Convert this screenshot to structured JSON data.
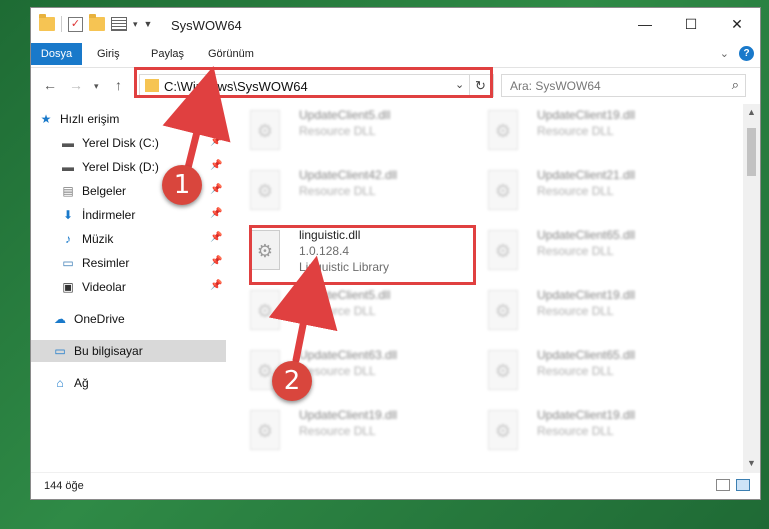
{
  "window": {
    "title": "SysWOW64"
  },
  "ribbon": {
    "tabs": [
      "Dosya",
      "Giriş",
      "Paylaş",
      "Görünüm"
    ]
  },
  "address": {
    "path": "C:\\Windows\\SysWOW64"
  },
  "search": {
    "placeholder": "Ara: SysWOW64"
  },
  "sidebar": {
    "items": [
      {
        "label": "Hızlı erişim",
        "icon": "star-icon"
      },
      {
        "label": "Yerel Disk (C:)",
        "icon": "drive-icon"
      },
      {
        "label": "Yerel Disk (D:)",
        "icon": "drive-icon"
      },
      {
        "label": "Belgeler",
        "icon": "documents-icon"
      },
      {
        "label": "İndirmeler",
        "icon": "download-icon"
      },
      {
        "label": "Müzik",
        "icon": "music-icon"
      },
      {
        "label": "Resimler",
        "icon": "pictures-icon"
      },
      {
        "label": "Videolar",
        "icon": "videos-icon"
      },
      {
        "label": "OneDrive",
        "icon": "cloud-icon"
      },
      {
        "label": "Bu bilgisayar",
        "icon": "computer-icon"
      },
      {
        "label": "Ağ",
        "icon": "network-icon"
      }
    ]
  },
  "files": [
    {
      "name": "UpdateClient5.dll",
      "type": "Resource DLL"
    },
    {
      "name": "UpdateClient19.dll",
      "type": "Resource DLL"
    },
    {
      "name": "UpdateClient42.dll",
      "type": "Resource DLL"
    },
    {
      "name": "UpdateClient21.dll",
      "type": "Resource DLL"
    },
    {
      "name": "linguistic.dll",
      "version": "1.0.128.4",
      "type": "Linguistic Library"
    },
    {
      "name": "UpdateClient65.dll",
      "type": "Resource DLL"
    },
    {
      "name": "UpdateClient5.dll",
      "type": "Resource DLL"
    },
    {
      "name": "UpdateClient19.dll",
      "type": "Resource DLL"
    },
    {
      "name": "UpdateClient63.dll",
      "type": "Resource DLL"
    },
    {
      "name": "UpdateClient65.dll",
      "type": "Resource DLL"
    },
    {
      "name": "UpdateClient19.dll",
      "type": "Resource DLL"
    },
    {
      "name": "UpdateClient19.dll",
      "type": "Resource DLL"
    }
  ],
  "status": {
    "item_count": "144 öğe"
  },
  "callouts": [
    "1",
    "2"
  ],
  "colors": {
    "accent": "#1979ca",
    "highlight": "#e04040",
    "callout": "#d9463d"
  }
}
